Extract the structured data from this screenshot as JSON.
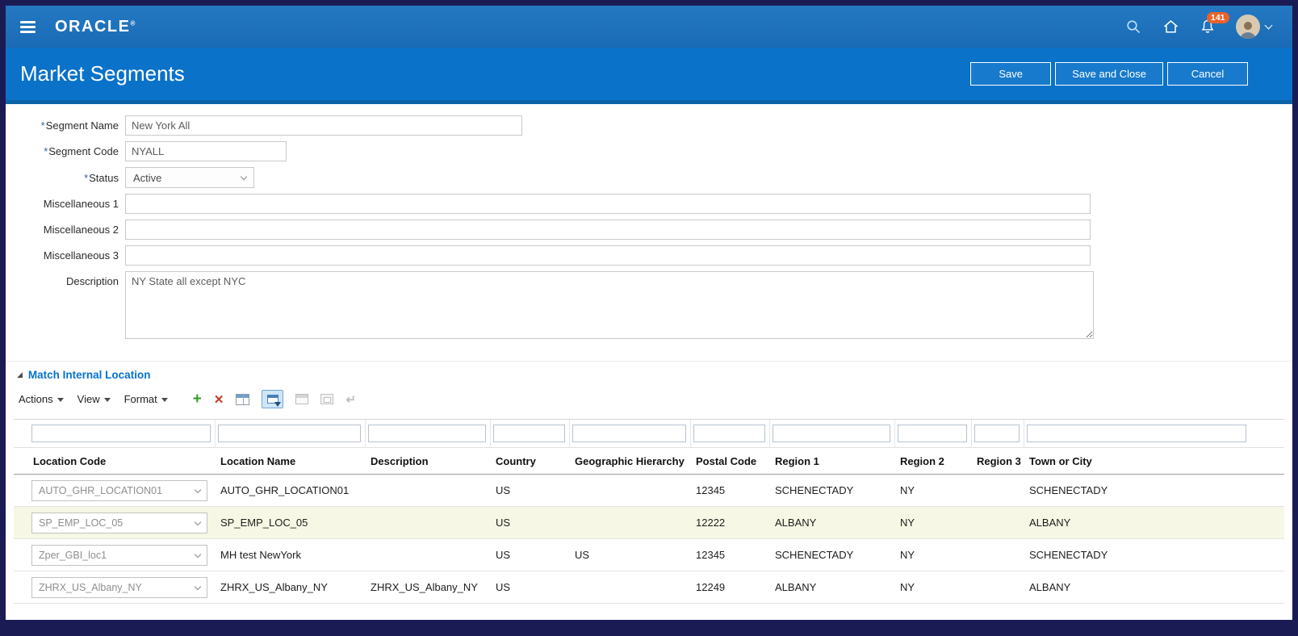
{
  "topbar": {
    "brand": "ORACLE",
    "brand_mark": "®",
    "notification_count": "141"
  },
  "header": {
    "title": "Market Segments",
    "save_label": "Save",
    "save_and_close_label": "Save and Close",
    "cancel_label": "Cancel"
  },
  "form": {
    "required_marker": "*",
    "segment_name": {
      "label": "Segment Name",
      "value": "New York All"
    },
    "segment_code": {
      "label": "Segment Code",
      "value": "NYALL"
    },
    "status": {
      "label": "Status",
      "value": "Active"
    },
    "misc1": {
      "label": "Miscellaneous 1",
      "value": ""
    },
    "misc2": {
      "label": "Miscellaneous 2",
      "value": ""
    },
    "misc3": {
      "label": "Miscellaneous 3",
      "value": ""
    },
    "description": {
      "label": "Description",
      "value": "NY State all except NYC"
    }
  },
  "section": {
    "title": "Match Internal Location",
    "menus": {
      "actions": "Actions",
      "view": "View",
      "format": "Format"
    },
    "icons": {
      "add": "plus",
      "delete": "x-cross",
      "freeze": "grid-table",
      "query_by_example": "filter-grid (active)",
      "detach": "window (disabled)",
      "expand": "window-in-window (disabled)",
      "wrap": "return-arrow (disabled)"
    }
  },
  "table": {
    "columns": [
      "Location Code",
      "Location Name",
      "Description",
      "Country",
      "Geographic Hierarchy",
      "Postal Code",
      "Region 1",
      "Region 2",
      "Region 3",
      "Town or City"
    ],
    "rows": [
      {
        "location_code": "AUTO_GHR_LOCATION01",
        "location_name": "AUTO_GHR_LOCATION01",
        "description": "",
        "country": "US",
        "geographic_hierarchy": "",
        "postal_code": "12345",
        "region1": "SCHENECTADY",
        "region2": "NY",
        "region3": "",
        "town_or_city": "SCHENECTADY",
        "selected": false
      },
      {
        "location_code": "SP_EMP_LOC_05",
        "location_name": "SP_EMP_LOC_05",
        "description": "",
        "country": "US",
        "geographic_hierarchy": "",
        "postal_code": "12222",
        "region1": "ALBANY",
        "region2": "NY",
        "region3": "",
        "town_or_city": "ALBANY",
        "selected": true
      },
      {
        "location_code": "Zper_GBI_loc1",
        "location_name": "MH test NewYork",
        "description": "",
        "country": "US",
        "geographic_hierarchy": "US",
        "postal_code": "12345",
        "region1": "SCHENECTADY",
        "region2": "NY",
        "region3": "",
        "town_or_city": "SCHENECTADY",
        "selected": false
      },
      {
        "location_code": "ZHRX_US_Albany_NY",
        "location_name": "ZHRX_US_Albany_NY",
        "description": "ZHRX_US_Albany_NY",
        "country": "US",
        "geographic_hierarchy": "",
        "postal_code": "12249",
        "region1": "ALBANY",
        "region2": "NY",
        "region3": "",
        "town_or_city": "ALBANY",
        "selected": false
      }
    ]
  },
  "colors": {
    "accent_blue": "#0572ce",
    "header_band_blue": "#0a72c9",
    "badge_orange": "#e8632c",
    "selected_row": "#f6f7e4",
    "frame_navy": "#1a1b55"
  }
}
